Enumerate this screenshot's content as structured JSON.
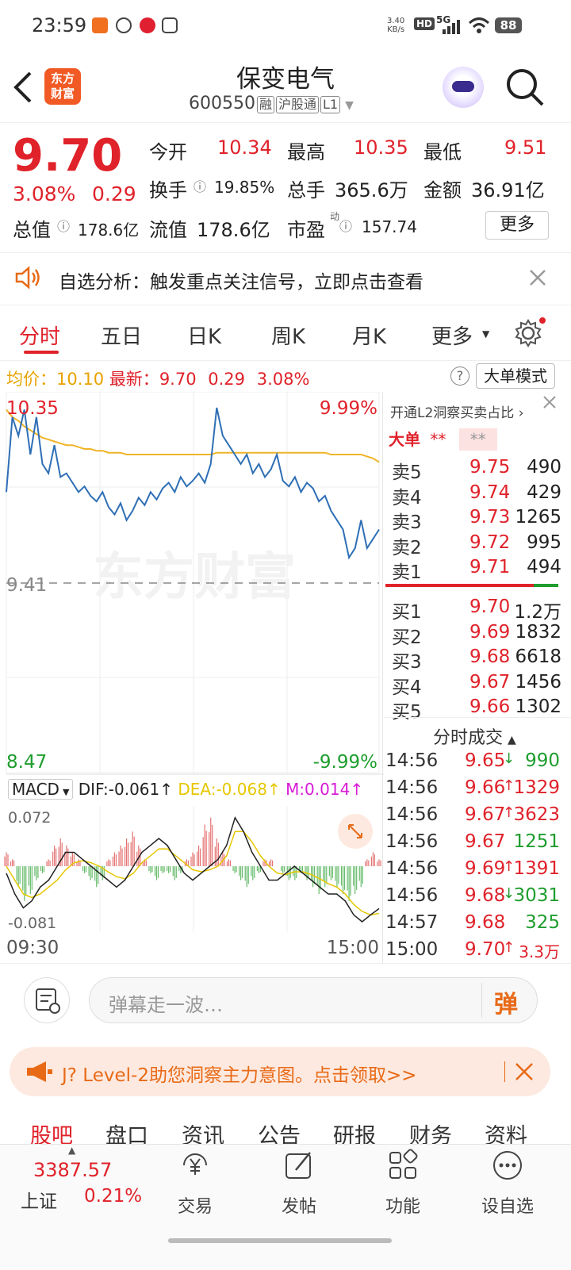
{
  "status_bar": {
    "time": "23:59",
    "speed": "3.40\nKB/s",
    "net_badge": "HD",
    "net_gen": "5G",
    "battery": "88"
  },
  "header": {
    "title": "保变电气",
    "code": "600550",
    "badges": [
      "融",
      "沪股通",
      "L1"
    ],
    "logo_text": "东方\n财富"
  },
  "quote": {
    "price": "9.70",
    "change_pct": "3.08%",
    "change": "0.29",
    "open_label": "今开",
    "open": "10.34",
    "high_label": "最高",
    "high": "10.35",
    "low_label": "最低",
    "low": "9.51",
    "turnover_label": "换手",
    "turnover": "19.85%",
    "volume_label": "总手",
    "volume": "365.6万",
    "amount_label": "金额",
    "amount": "36.91亿",
    "mktcap_label": "总值",
    "mktcap": "178.6亿",
    "float_label": "流值",
    "float": "178.6亿",
    "pe_label": "市盈",
    "pe_sup": "动",
    "pe": "157.74",
    "more_btn": "更多"
  },
  "alert": {
    "text": "自选分析：触发重点关注信号，立即点击查看"
  },
  "chart_tabs": [
    "分时",
    "五日",
    "日K",
    "周K",
    "月K",
    "更多"
  ],
  "chart_info": {
    "avg_label": "均价：",
    "avg": "10.10",
    "last_label": "最新：",
    "last": "9.70",
    "chg": "0.29",
    "pct": "3.08%",
    "mode_btn": "大单模式"
  },
  "chart_data": {
    "type": "line",
    "ylim": [
      8.47,
      10.35
    ],
    "prev_close": 9.41,
    "ytick_top": "10.35",
    "ytick_mid": "9.41",
    "ytick_bottom": "8.47",
    "pct_top": "9.99%",
    "pct_bottom": "-9.99%",
    "xtick_start": "09:30",
    "xtick_end": "15:00",
    "watermark": "东方财富",
    "series": [
      {
        "values": [
          9.9,
          10.3,
          10.2,
          10.34,
          10.1,
          10.3,
          10.05,
          10.0,
          10.15,
          9.98,
          10.0,
          9.95,
          9.9,
          9.93,
          9.88,
          9.85,
          9.9,
          9.82,
          9.78,
          9.84,
          9.75,
          9.8,
          9.87,
          9.83,
          9.9,
          9.86,
          9.92,
          9.95,
          9.9,
          9.98,
          9.93,
          9.96,
          10.0,
          9.95,
          10.05,
          10.35,
          10.2,
          10.15,
          10.1,
          10.05,
          10.1,
          10.0,
          10.05,
          9.98,
          10.02,
          10.1,
          9.96,
          9.93,
          9.98,
          9.9,
          9.95,
          9.92,
          9.85,
          9.88,
          9.8,
          9.75,
          9.7,
          9.55,
          9.6,
          9.75,
          9.6,
          9.65,
          9.7
        ]
      },
      {
        "values": [
          10.34,
          10.3,
          10.28,
          10.25,
          10.23,
          10.21,
          10.19,
          10.18,
          10.17,
          10.16,
          10.15,
          10.15,
          10.14,
          10.13,
          10.13,
          10.12,
          10.12,
          10.11,
          10.11,
          10.11,
          10.1,
          10.1,
          10.1,
          10.1,
          10.1,
          10.1,
          10.1,
          10.1,
          10.1,
          10.1,
          10.1,
          10.1,
          10.1,
          10.1,
          10.1,
          10.11,
          10.11,
          10.11,
          10.11,
          10.11,
          10.11,
          10.11,
          10.11,
          10.11,
          10.11,
          10.11,
          10.11,
          10.11,
          10.11,
          10.11,
          10.11,
          10.11,
          10.11,
          10.11,
          10.1,
          10.1,
          10.1,
          10.1,
          10.1,
          10.1,
          10.09,
          10.08,
          10.06
        ]
      }
    ]
  },
  "macd": {
    "label": "MACD",
    "dif": "DIF:-0.061↑",
    "dea": "DEA:-0.068↑",
    "m": "M:0.014↑",
    "ytop": "0.072",
    "ybottom": "-0.081",
    "hist": [
      0.02,
      0.01,
      -0.03,
      -0.05,
      -0.04,
      -0.02,
      -0.01,
      0.01,
      0.03,
      0.04,
      0.03,
      0.02,
      0.01,
      -0.01,
      -0.02,
      -0.03,
      -0.02,
      0.01,
      0.02,
      0.03,
      0.04,
      0.05,
      0.03,
      0.01,
      -0.01,
      -0.02,
      -0.01,
      -0.01,
      -0.02,
      -0.01,
      0.01,
      0.02,
      0.03,
      0.06,
      0.07,
      0.04,
      0.02,
      0.01,
      -0.01,
      -0.02,
      -0.03,
      -0.02,
      -0.01,
      0.01,
      0.01,
      0.0,
      -0.01,
      -0.02,
      -0.02,
      -0.01,
      -0.02,
      -0.03,
      -0.04,
      -0.03,
      -0.02,
      -0.03,
      -0.04,
      -0.05,
      -0.04,
      -0.03,
      0.01,
      0.02,
      0.01
    ],
    "dif_line": [
      -0.01,
      -0.04,
      -0.06,
      -0.05,
      -0.03,
      -0.02,
      0.0,
      0.02,
      0.02,
      0.01,
      0.0,
      -0.01,
      -0.02,
      -0.03,
      -0.02,
      0.0,
      0.02,
      0.03,
      0.04,
      0.03,
      0.01,
      -0.01,
      -0.02,
      -0.01,
      0.0,
      0.01,
      0.03,
      0.07,
      0.05,
      0.02,
      0.0,
      -0.02,
      -0.02,
      -0.01,
      0.0,
      -0.01,
      -0.02,
      -0.03,
      -0.04,
      -0.04,
      -0.05,
      -0.07,
      -0.08,
      -0.07,
      -0.061
    ],
    "dea_line": [
      0.0,
      -0.02,
      -0.04,
      -0.045,
      -0.04,
      -0.03,
      -0.02,
      -0.005,
      0.005,
      0.008,
      0.005,
      0.0,
      -0.008,
      -0.015,
      -0.018,
      -0.01,
      0.005,
      0.015,
      0.025,
      0.025,
      0.015,
      0.005,
      -0.005,
      -0.008,
      -0.005,
      0.0,
      0.015,
      0.05,
      0.05,
      0.035,
      0.015,
      0.0,
      -0.01,
      -0.012,
      -0.008,
      -0.008,
      -0.012,
      -0.018,
      -0.025,
      -0.03,
      -0.04,
      -0.055,
      -0.065,
      -0.07,
      -0.068
    ]
  },
  "orderbook": {
    "link": "开通L2洞察买卖占比",
    "big_order": "大单",
    "big_val1": "**",
    "big_val2": "**",
    "asks": [
      {
        "label": "卖5",
        "price": "9.75",
        "vol": "490"
      },
      {
        "label": "卖4",
        "price": "9.74",
        "vol": "429"
      },
      {
        "label": "卖3",
        "price": "9.73",
        "vol": "1265"
      },
      {
        "label": "卖2",
        "price": "9.72",
        "vol": "995"
      },
      {
        "label": "卖1",
        "price": "9.71",
        "vol": "494"
      }
    ],
    "bids": [
      {
        "label": "买1",
        "price": "9.70",
        "vol": "1.2万"
      },
      {
        "label": "买2",
        "price": "9.69",
        "vol": "1832"
      },
      {
        "label": "买3",
        "price": "9.68",
        "vol": "6618"
      },
      {
        "label": "买4",
        "price": "9.67",
        "vol": "1456"
      },
      {
        "label": "买5",
        "price": "9.66",
        "vol": "1302"
      }
    ],
    "ratio_red": 0.86
  },
  "trades": {
    "title": "分时成交",
    "rows": [
      {
        "time": "14:56",
        "price": "9.65",
        "arrow": "↓",
        "vol": "990",
        "dir": "down"
      },
      {
        "time": "14:56",
        "price": "9.66",
        "arrow": "↑",
        "vol": "1329",
        "dir": "up"
      },
      {
        "time": "14:56",
        "price": "9.67",
        "arrow": "↑",
        "vol": "3623",
        "dir": "up"
      },
      {
        "time": "14:56",
        "price": "9.67",
        "arrow": "",
        "vol": "1251",
        "dir": "flat"
      },
      {
        "time": "14:56",
        "price": "9.69",
        "arrow": "↑",
        "vol": "1391",
        "dir": "up"
      },
      {
        "time": "14:56",
        "price": "9.68",
        "arrow": "↓",
        "vol": "3031",
        "dir": "down"
      },
      {
        "time": "14:57",
        "price": "9.68",
        "arrow": "",
        "vol": "325",
        "dir": "flat"
      },
      {
        "time": "15:00",
        "price": "9.70",
        "arrow": "↑",
        "vol": "3.3万",
        "dir": "up"
      }
    ]
  },
  "comment": {
    "placeholder": "弹幕走一波…",
    "danmu": "弹"
  },
  "promo": {
    "text": "J? Level-2助您洞察主力意图。点击领取>>"
  },
  "bottom_tabs": [
    "股吧",
    "盘口",
    "资讯",
    "公告",
    "研报",
    "财务",
    "资料"
  ],
  "dock": {
    "index_value": "3387.57",
    "index_name": "上证",
    "index_pct": "0.21%",
    "items": [
      {
        "label": "交易",
        "icon": "yuan-icon"
      },
      {
        "label": "发帖",
        "icon": "edit-icon"
      },
      {
        "label": "功能",
        "icon": "grid-icon"
      },
      {
        "label": "设自选",
        "icon": "more-icon"
      }
    ]
  }
}
